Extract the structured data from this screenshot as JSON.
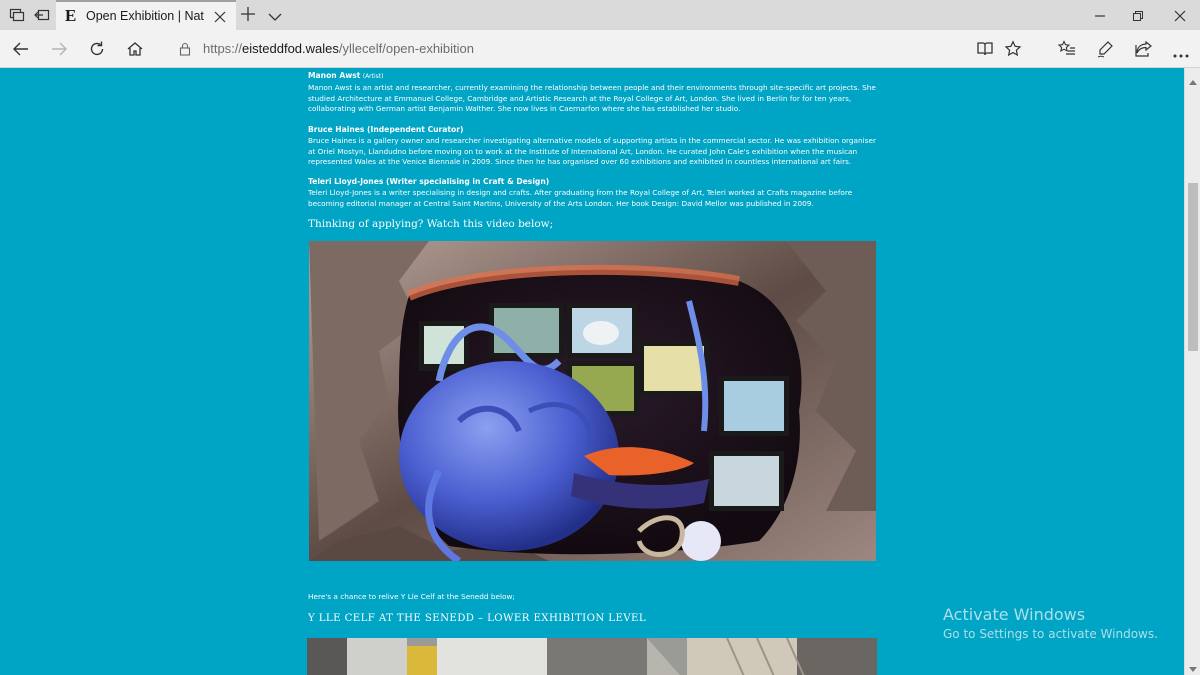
{
  "browser": {
    "tab_title": "Open Exhibition | National Eisteddfod",
    "tab_favicon": "E",
    "url_scheme": "https://",
    "url_host": "eisteddfod.wales",
    "url_path": "/yllecelf/open-exhibition",
    "icons": [
      "tab-groups-icon",
      "back-to-tabs-icon",
      "close-tab-icon",
      "new-tab-icon",
      "tab-list-chevron-icon",
      "minimize-icon",
      "restore-icon",
      "close-window-icon",
      "back-icon",
      "forward-icon",
      "refresh-icon",
      "home-icon",
      "lock-icon",
      "reading-view-icon",
      "favorite-star-icon",
      "favorites-hub-icon",
      "pen-icon",
      "share-icon",
      "more-icon"
    ]
  },
  "page": {
    "people": [
      {
        "name": "Manon Awst",
        "role": "(Artist)",
        "bio": "Manon Awst is an artist and researcher, currently examining the relationship between people and their environments through site-specific art projects. She studied Architecture at Emmanuel College, Cambridge and Artistic Research at the Royal College of Art, London. She lived in Berlin for for ten years, collaborating with German artist Benjamin Walther. She now lives in Caernarfon where she has established her studio."
      },
      {
        "name": "Bruce Haines (Independent Curator)",
        "role": "",
        "bio": "Bruce Haines is a gallery owner and researcher investigating alternative models of supporting artists in the commercial sector. He was exhibition organiser at Oriel Mostyn, Llandudno before moving on to work at the Institute of International Art, London. He curated John Cale's exhibition when the musican represented Wales at the Venice Biennale in 2009. Since then he has organised over 60 exhibitions and exhibited in countless international art fairs."
      },
      {
        "name": "Teleri Lloyd-Jones (Writer specialising in Craft & Design)",
        "role": "",
        "bio": "Teleri Lloyd-Jones is a writer specialising in design and crafts. After graduating from the Royal College of Art, Teleri worked at Crafts magazine before becoming editorial manager at Central Saint Martins, University of the Arts London. Her book Design: David Mellor was published in 2009."
      }
    ],
    "video_prompt": "Thinking of applying? Watch this video below;",
    "relive_note": "Here's a chance to relive Y Lle Celf at the Senedd below;",
    "section_heading": "Y LLE CELF AT THE SENEDD – LOWER EXHIBITION LEVEL"
  },
  "watermark": {
    "line1": "Activate Windows",
    "line2": "Go to Settings to activate Windows."
  },
  "colors": {
    "page_background": "#00a4c4",
    "chrome_tabbar": "#dadada",
    "chrome_toolbar": "#f2f2f2"
  }
}
